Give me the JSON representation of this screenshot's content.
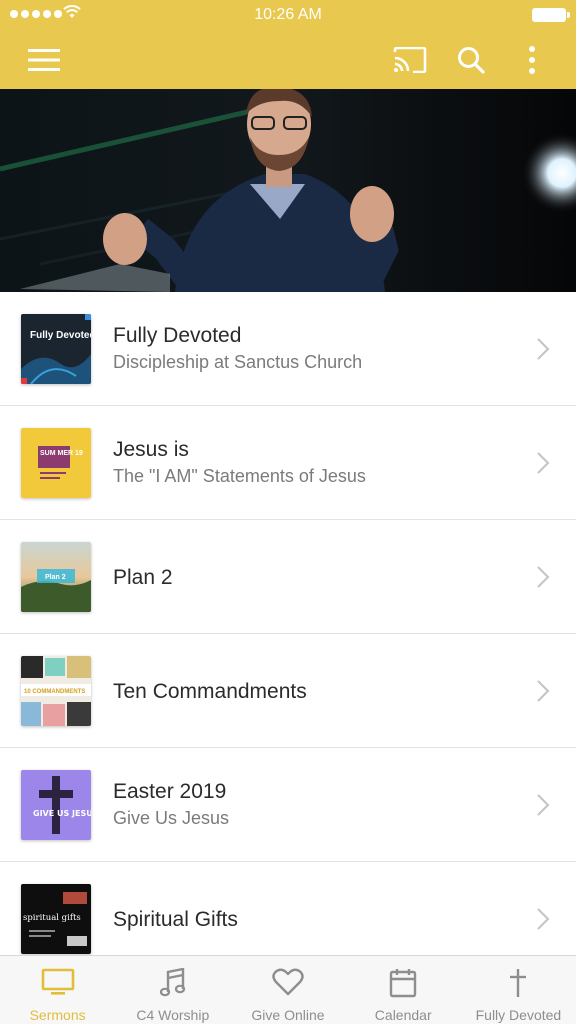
{
  "status_bar": {
    "time": "10:26 AM"
  },
  "header": {
    "background_color": "#e8c84e",
    "icons": [
      "menu-icon",
      "cast-icon",
      "search-icon",
      "more-vertical-icon"
    ]
  },
  "sermon_series": [
    {
      "title": "Fully Devoted",
      "subtitle": "Discipleship at Sanctus Church",
      "thumb_text": "Fully Devoted"
    },
    {
      "title": "Jesus is",
      "subtitle": "The \"I AM\" Statements of Jesus",
      "thumb_text": "SUM MER 19"
    },
    {
      "title": "Plan 2",
      "subtitle": "",
      "thumb_text": "Plan 2"
    },
    {
      "title": "Ten Commandments",
      "subtitle": "",
      "thumb_text": "10 COMMANDMENTS"
    },
    {
      "title": "Easter 2019",
      "subtitle": "Give Us Jesus",
      "thumb_text": "GIVE US JESUS"
    },
    {
      "title": "Spiritual Gifts",
      "subtitle": "",
      "thumb_text": "spiritual gifts"
    }
  ],
  "tab_bar": {
    "active_color": "#e2bd3a",
    "tabs": [
      {
        "label": "Sermons",
        "icon": "monitor-icon",
        "active": true
      },
      {
        "label": "C4 Worship",
        "icon": "music-note-icon",
        "active": false
      },
      {
        "label": "Give Online",
        "icon": "heart-icon",
        "active": false
      },
      {
        "label": "Calendar",
        "icon": "calendar-icon",
        "active": false
      },
      {
        "label": "Fully Devoted",
        "icon": "cross-icon",
        "active": false
      }
    ]
  }
}
